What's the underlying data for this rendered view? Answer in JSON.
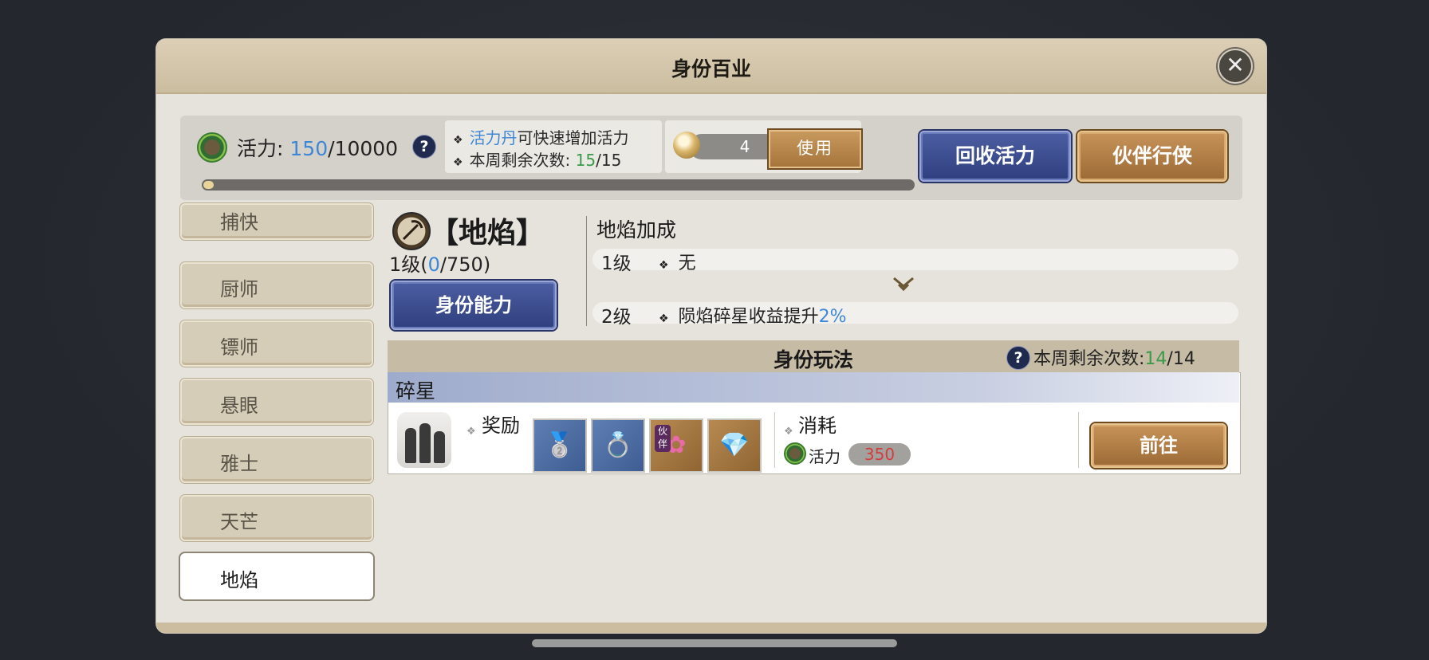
{
  "dialog": {
    "title": "身份百业"
  },
  "stamina": {
    "label": "活力:",
    "current": "150",
    "max": "/10000",
    "progress": 0.015
  },
  "tips": {
    "line1_highlight": "活力丹",
    "line1_rest": "可快速增加活力",
    "line2_label": "本周剩余次数: ",
    "line2_used": "15",
    "line2_total": "/15"
  },
  "pill": {
    "count": "4",
    "use_label": "使用"
  },
  "buttons": {
    "recycle": "回收活力",
    "partner": "伙伴行侠",
    "ability": "身份能力",
    "go": "前往"
  },
  "sidebar": {
    "items": [
      {
        "label": "捕快"
      },
      {
        "label": "厨师"
      },
      {
        "label": "镖师"
      },
      {
        "label": "悬眼"
      },
      {
        "label": "雅士"
      },
      {
        "label": "天芒"
      },
      {
        "label": "地焰"
      }
    ],
    "active_index": 6
  },
  "identity": {
    "title": "【地焰】",
    "level_prefix": "1级(",
    "exp_cur": "0",
    "exp_max": "/750)"
  },
  "bonus": {
    "title": "地焰加成",
    "rows": [
      {
        "level": "1级",
        "text": "无",
        "percent": ""
      },
      {
        "level": "2级",
        "text": "陨焰碎星收益提升",
        "percent": "2%"
      }
    ]
  },
  "gameplay": {
    "title": "身份玩法",
    "remain_label": "本周剩余次数:",
    "remain_cur": "14",
    "remain_total": "/14",
    "card": {
      "name": "碎星",
      "reward_label": "奖励",
      "reward_items": [
        {
          "icon": "silver-ingot-icon",
          "glyph": "🥈",
          "bg": "blue"
        },
        {
          "icon": "armlet-icon",
          "glyph": "💍",
          "bg": "blue"
        },
        {
          "icon": "partner-gift-icon",
          "glyph": "✿",
          "bg": "gold",
          "tag": "伙伴"
        },
        {
          "icon": "crystal-icon",
          "glyph": "💎",
          "bg": "gold"
        }
      ],
      "cost_label": "消耗",
      "cost_name": "活力",
      "cost_value": "350"
    }
  },
  "colors": {
    "accent_blue": "#3e86d6",
    "accent_green": "#3a9a4a",
    "cost_red": "#d33d3d"
  }
}
